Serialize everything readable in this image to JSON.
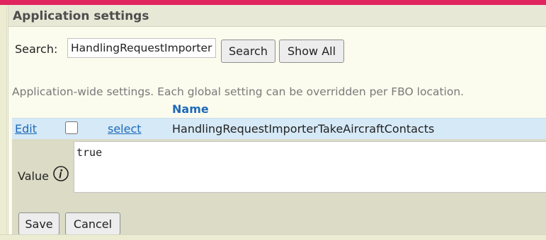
{
  "panel": {
    "title": "Application settings"
  },
  "search": {
    "label": "Search:",
    "value": "HandlingRequestImporter",
    "search_button": "Search",
    "show_all_button": "Show All"
  },
  "description": "Application-wide settings. Each global setting can be overridden per FBO location.",
  "table": {
    "columns": [
      "Name"
    ],
    "rows": [
      {
        "edit_label": "Edit",
        "select_label": "select",
        "checked": false,
        "name": "HandlingRequestImporterTakeAircraftContacts"
      }
    ]
  },
  "editor": {
    "value_label": "Value",
    "info_icon": "info-icon",
    "value": "true",
    "save_button": "Save",
    "cancel_button": "Cancel"
  },
  "colors": {
    "accent_top": "#e0245e",
    "link": "#1e6ab8",
    "row_highlight": "#d6e9f7"
  }
}
